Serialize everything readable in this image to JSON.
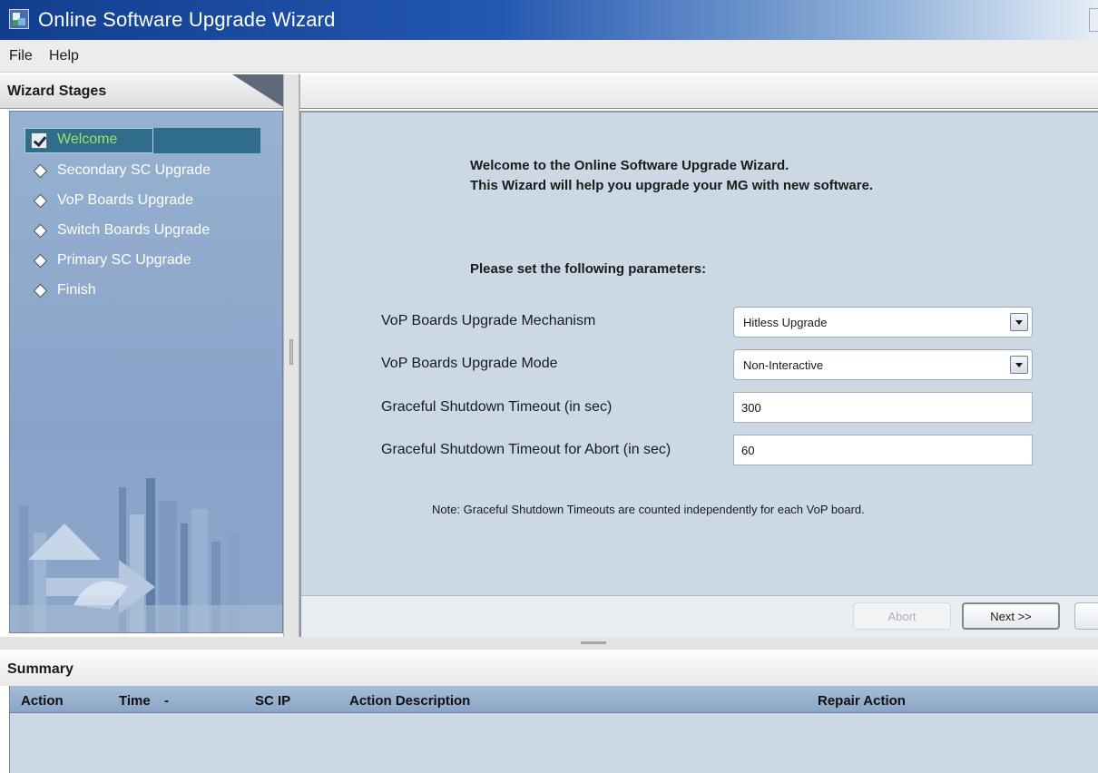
{
  "window": {
    "title": "Online Software Upgrade Wizard"
  },
  "menu": {
    "items": [
      "File",
      "Help"
    ]
  },
  "stages": {
    "header": "Wizard Stages",
    "items": [
      {
        "label": "Welcome",
        "active": true
      },
      {
        "label": "Secondary SC Upgrade",
        "active": false
      },
      {
        "label": "VoP Boards Upgrade",
        "active": false
      },
      {
        "label": "Switch Boards Upgrade",
        "active": false
      },
      {
        "label": "Primary SC Upgrade",
        "active": false
      },
      {
        "label": "Finish",
        "active": false
      }
    ]
  },
  "main": {
    "welcome_line1": "Welcome to the Online Software Upgrade Wizard.",
    "welcome_line2": "This Wizard will help you upgrade your MG with new software.",
    "params_title": "Please set the following parameters:",
    "fields": {
      "mechanism": {
        "label": "VoP Boards Upgrade Mechanism",
        "value": "Hitless Upgrade"
      },
      "mode": {
        "label": "VoP Boards Upgrade Mode",
        "value": "Non-Interactive"
      },
      "shutdown_timeout": {
        "label": "Graceful Shutdown Timeout (in sec)",
        "value": "300"
      },
      "abort_timeout": {
        "label": "Graceful Shutdown Timeout for Abort (in sec)",
        "value": "60"
      }
    },
    "note": "Note: Graceful Shutdown Timeouts are counted independently for each VoP board."
  },
  "buttons": {
    "abort": "Abort",
    "next": "Next >>"
  },
  "summary": {
    "title": "Summary",
    "columns": [
      "Action",
      "Time",
      "SC IP",
      "Action Description",
      "Repair Action"
    ],
    "sort_indicator": "-"
  },
  "colors": {
    "title_bar": "#2357b0",
    "stage_panel": "#8aa5c8",
    "content_panel": "#ccd9e5",
    "active_stage_text": "#9fe06a"
  }
}
